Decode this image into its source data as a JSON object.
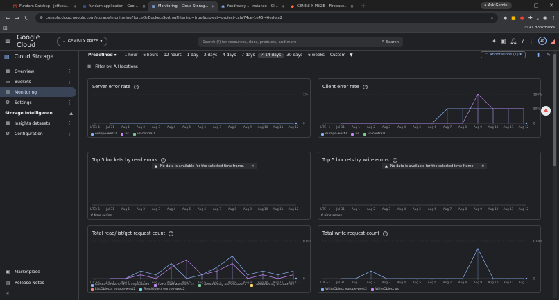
{
  "browser": {
    "tabs": [
      {
        "title": "Fundam Catchup - jeffukus@g",
        "icon": "gmail-icon",
        "color": "#ea4335",
        "glyph": "M"
      },
      {
        "title": "fundam application - Google D",
        "icon": "docs-icon",
        "color": "#4285f4",
        "glyph": "▤"
      },
      {
        "title": "Monitoring – Cloud Storage – ",
        "icon": "cloud-icon",
        "color": "#8ab4f8",
        "glyph": "▦"
      },
      {
        "title": "fundready-... instance – Cloud",
        "icon": "cloud-icon",
        "color": "#8ab4f8",
        "glyph": "◉"
      },
      {
        "title": "GEMINI X PRIZE – Firebase con",
        "icon": "firebase-icon",
        "color": "#ff7043",
        "glyph": "◆"
      }
    ],
    "new_tab": "+",
    "ask_gemini": "Ask Gemini",
    "url": "console.cloud.google.com/storage/monitoring?forceOnBucketsSortingFiltering=true&project=project-ccfa74ce-1e45-46ed-aa2",
    "all_bookmarks": "All Bookmarks"
  },
  "header": {
    "logo": "Google Cloud",
    "project": "GEMINI X PRIZE",
    "search_placeholder": "Search (/) for resources, docs, products, and more",
    "search_button": "Search",
    "avatar": "18"
  },
  "sidebar": {
    "title": "Cloud Storage",
    "items": [
      {
        "label": "Overview",
        "icon": "overview-icon"
      },
      {
        "label": "Buckets",
        "icon": "bucket-icon"
      },
      {
        "label": "Monitoring",
        "icon": "monitoring-icon"
      },
      {
        "label": "Settings",
        "icon": "settings-icon"
      }
    ],
    "section": "Storage Intelligence",
    "sub_items": [
      {
        "label": "Insights datasets"
      },
      {
        "label": "Configuration"
      }
    ],
    "bottom": [
      {
        "label": "Marketplace"
      },
      {
        "label": "Release Notes"
      }
    ]
  },
  "toolbar": {
    "predefined": "Predefined",
    "ranges": [
      "1 hour",
      "6 hours",
      "12 hours",
      "1 day",
      "2 days",
      "4 days",
      "7 days",
      "14 days",
      "30 days",
      "6 weeks",
      "Custom"
    ],
    "selected": "14 days",
    "annotations": "Annotations (1)",
    "filter": "Filter by: All locations"
  },
  "x_ticks": [
    "UTC+1",
    "Jul 31",
    "Aug 1",
    "Aug 2",
    "Aug 3",
    "Aug 4",
    "Aug 5",
    "Aug 6",
    "Aug 7",
    "Aug 8",
    "Aug 9",
    "Aug 10",
    "Aug 11",
    "Aug 12"
  ],
  "no_data_message": "No data is available for the selected time frame.",
  "no_time_series": "0 time series",
  "colors": {
    "accent": "#8ab4f8",
    "series1": "#8ab4f8",
    "series2": "#c58af9",
    "series3": "#81c995",
    "series4": "#fdd663"
  },
  "cards": [
    {
      "title": "Server error rate",
      "y_ticks": [
        "1%",
        "0"
      ],
      "legend": [
        {
          "name": "europe-west2",
          "color": "#8ab4f8"
        },
        {
          "name": "us",
          "color": "#c58af9"
        },
        {
          "name": "us-central1",
          "color": "#81c995"
        }
      ]
    },
    {
      "title": "Client error rate",
      "y_ticks": [
        "100%",
        "50%",
        "0"
      ],
      "legend": [
        {
          "name": "europe-west2",
          "color": "#8ab4f8"
        },
        {
          "name": "us",
          "color": "#c58af9"
        },
        {
          "name": "us-central1",
          "color": "#81c995"
        }
      ]
    },
    {
      "title": "Top 5 buckets by read errors",
      "y_ticks": []
    },
    {
      "title": "Top 5 buckets by write errors",
      "y_ticks": []
    },
    {
      "title": "Total read/list/get request count",
      "y_ticks": [
        "0.01/s",
        "0"
      ],
      "legend": [
        {
          "name": "GetBucketMetadata europe-west2",
          "color": "#8ab4f8"
        },
        {
          "name": "GetBucketMetadata us",
          "color": "#c58af9"
        },
        {
          "name": "GetIamPolicy europe-west2",
          "color": "#81c995"
        },
        {
          "name": "GetIamPolicy us-central1",
          "color": "#fdd663"
        },
        {
          "name": "ListObjects europe-west2",
          "color": "#f28b82"
        },
        {
          "name": "ReadObject europe-west2",
          "color": "#78d9ec"
        }
      ]
    },
    {
      "title": "Total write request count",
      "y_ticks": [
        "0.005/s",
        "0"
      ],
      "legend": [
        {
          "name": "WriteObject europe-west2",
          "color": "#8ab4f8"
        },
        {
          "name": "WriteObject us",
          "color": "#c58af9"
        }
      ]
    }
  ],
  "chart_data": [
    {
      "type": "line",
      "title": "Server error rate",
      "x": [
        "Jul 31",
        "Aug 1",
        "Aug 2",
        "Aug 3",
        "Aug 4",
        "Aug 5",
        "Aug 6",
        "Aug 7",
        "Aug 8",
        "Aug 9",
        "Aug 10",
        "Aug 11",
        "Aug 12"
      ],
      "ylim": [
        0,
        1
      ],
      "series": [
        {
          "name": "europe-west2",
          "values": [
            0,
            0,
            0,
            0,
            0,
            0,
            0,
            0,
            0,
            0,
            0,
            0,
            0
          ]
        }
      ]
    },
    {
      "type": "line",
      "title": "Client error rate",
      "x": [
        "Jul 31",
        "Aug 1",
        "Aug 2",
        "Aug 3",
        "Aug 4",
        "Aug 5",
        "Aug 6",
        "Aug 7",
        "Aug 8",
        "Aug 9",
        "Aug 10",
        "Aug 11",
        "Aug 12"
      ],
      "ylim": [
        0,
        100
      ],
      "series": [
        {
          "name": "europe-west2",
          "values": [
            0,
            0,
            0,
            0,
            0,
            0,
            0,
            50,
            50,
            50,
            50,
            50,
            50
          ]
        },
        {
          "name": "us",
          "values": [
            0,
            0,
            0,
            0,
            0,
            0,
            0,
            0,
            0,
            100,
            50,
            50,
            50
          ]
        }
      ]
    },
    {
      "type": "line",
      "title": "Total read/list/get request count",
      "x": [
        "Jul 31",
        "Aug 1",
        "Aug 2",
        "Aug 3",
        "Aug 4",
        "Aug 5",
        "Aug 6",
        "Aug 7",
        "Aug 8",
        "Aug 9",
        "Aug 10",
        "Aug 11",
        "Aug 12"
      ],
      "ylim": [
        0,
        0.01
      ],
      "series": [
        {
          "name": "GetBucketMetadata europe-west2",
          "values": [
            0,
            0,
            0.002,
            0.001,
            0.004,
            0,
            0.001,
            0.003,
            0.006,
            0.001,
            0.002,
            0.001,
            0.002
          ]
        },
        {
          "name": "GetIamPolicy europe-west2",
          "values": [
            0,
            0,
            0.001,
            0,
            0.003,
            0.005,
            0.001,
            0.002,
            0.004,
            0,
            0.001,
            0,
            0.001
          ]
        }
      ]
    },
    {
      "type": "line",
      "title": "Total write request count",
      "x": [
        "Jul 31",
        "Aug 1",
        "Aug 2",
        "Aug 3",
        "Aug 4",
        "Aug 5",
        "Aug 6",
        "Aug 7",
        "Aug 8",
        "Aug 9",
        "Aug 10",
        "Aug 11",
        "Aug 12"
      ],
      "ylim": [
        0,
        0.005
      ],
      "series": [
        {
          "name": "WriteObject europe-west2",
          "values": [
            0,
            0,
            0.001,
            0,
            0,
            0,
            0,
            0,
            0,
            0.004,
            0,
            0,
            0
          ]
        }
      ]
    }
  ]
}
